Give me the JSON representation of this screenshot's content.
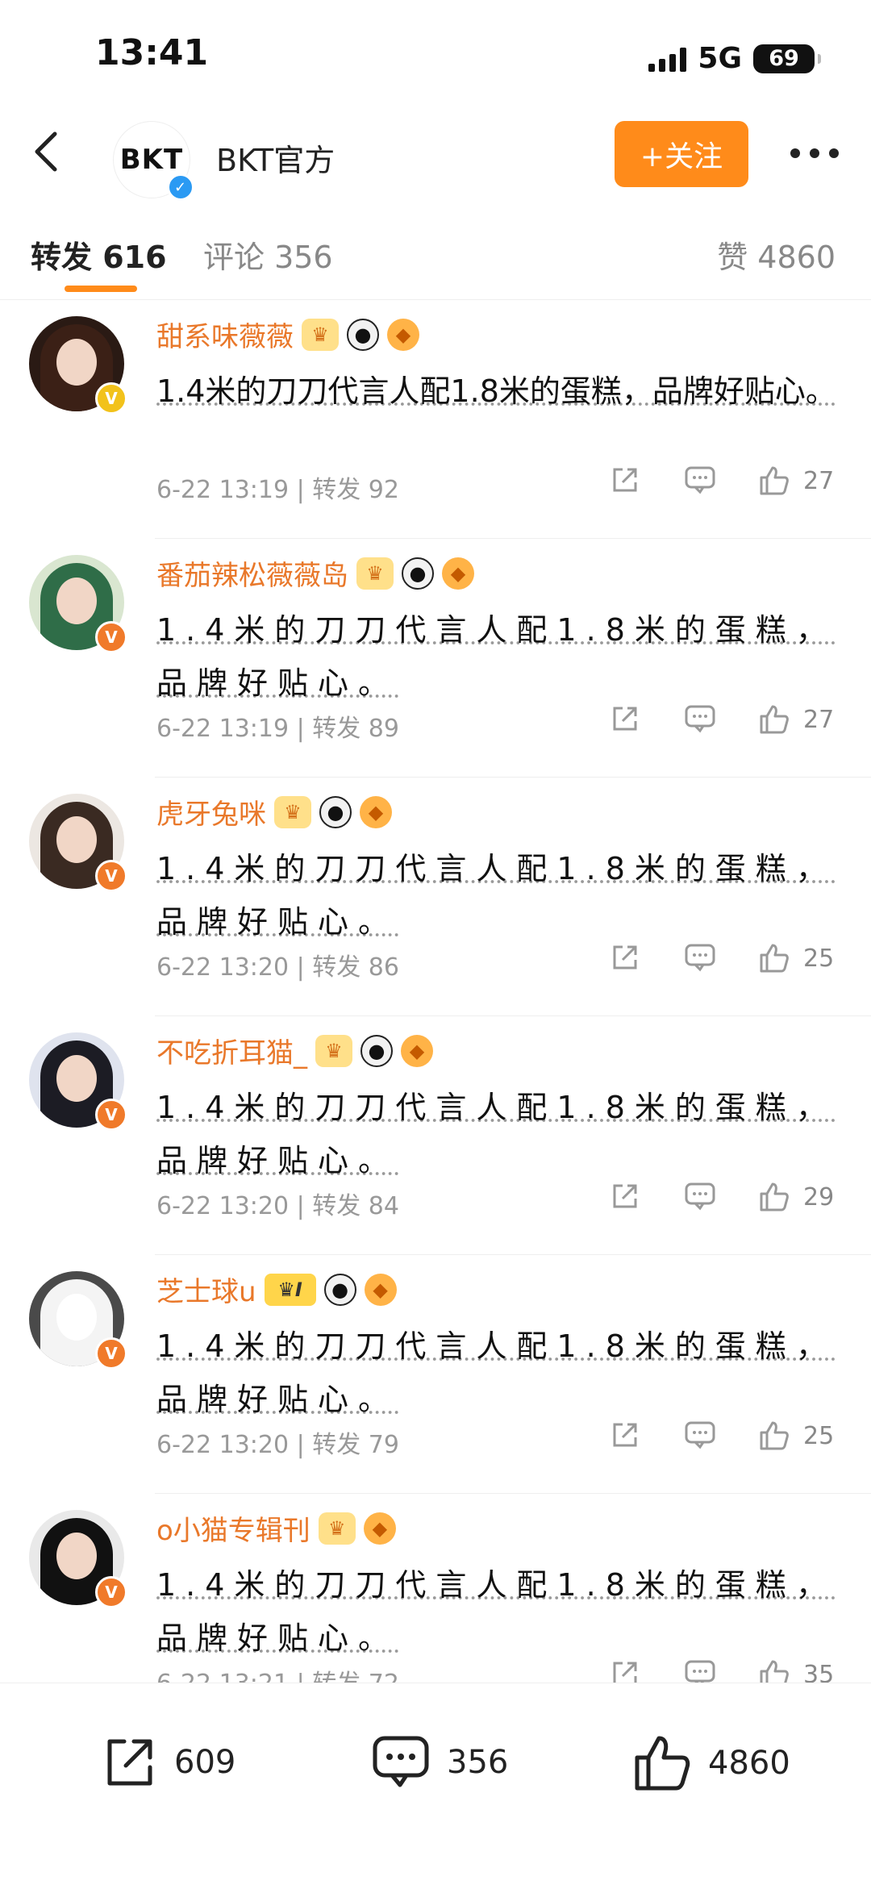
{
  "status_bar": {
    "time": "13:41",
    "network": "5G",
    "battery": "69"
  },
  "header": {
    "account_name": "BKT官方",
    "avatar_text": "BKT",
    "follow_label": "+关注"
  },
  "tabs": {
    "repost": "转发 616",
    "comment": "评论 356",
    "like": "赞 4860"
  },
  "posts": [
    {
      "username": "甜系味薇薇",
      "text": "1.4米的刀刀代言人配1.8米的蛋糕，品牌好贴心。",
      "time": "6-22 13:19",
      "reposts": "转发 92",
      "likes": "27"
    },
    {
      "username": "番茄辣松薇薇岛",
      "text": "1.4米的刀刀代言人配1.8米的蛋糕，品牌好贴心。",
      "time": "6-22 13:19",
      "reposts": "转发 89",
      "likes": "27"
    },
    {
      "username": "虎牙兔咪",
      "text": "1.4米的刀刀代言人配1.8米的蛋糕，品牌好贴心。",
      "time": "6-22 13:20",
      "reposts": "转发 86",
      "likes": "25"
    },
    {
      "username": "不吃折耳猫_",
      "text": "1.4米的刀刀代言人配1.8米的蛋糕，品牌好贴心。",
      "time": "6-22 13:20",
      "reposts": "转发 84",
      "likes": "29"
    },
    {
      "username": "芝士球u",
      "text": "1.4米的刀刀代言人配1.8米的蛋糕，品牌好贴心。",
      "time": "6-22 13:20",
      "reposts": "转发 79",
      "likes": "25"
    },
    {
      "username": "o小猫专辑刊",
      "text": "1.4米的刀刀代言人配1.8米的蛋糕，品牌好贴心。",
      "time": "6-22 13:21",
      "reposts": "转发 72",
      "likes": "35"
    }
  ],
  "bottom_bar": {
    "share_count": "609",
    "comment_count": "356",
    "like_count": "4860"
  },
  "colors": {
    "accent": "#ff8b1a",
    "username": "#e9782a",
    "verified_blue": "#2b9af3",
    "verified_orange": "#f07a2a",
    "verified_gold": "#f2c21b"
  },
  "icons": [
    "back-icon",
    "verified-icon",
    "more-icon",
    "share-icon",
    "comment-icon",
    "like-icon",
    "crown-icon",
    "panda-icon",
    "fish-icon"
  ]
}
